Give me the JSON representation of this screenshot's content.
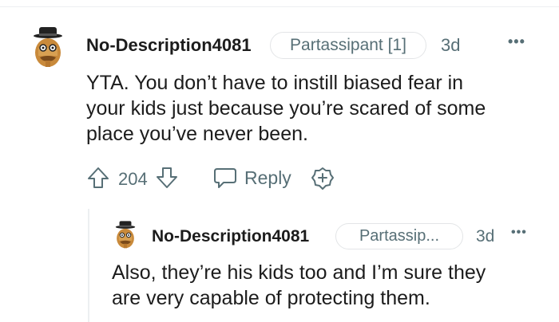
{
  "comment": {
    "username": "No-Description4081",
    "flair": "Partassipant [1]",
    "time": "3d",
    "more_label": "•••",
    "body_lines": [
      "YTA. You don’t have to instill biased fear in",
      "your kids just because you’re scared of some",
      "place you’ve never been."
    ],
    "vote_count": "204",
    "reply_label": "Reply"
  },
  "reply": {
    "username": "No-Description4081",
    "flair": "Partassip...",
    "time": "3d",
    "more_label": "•••",
    "body_lines": [
      "Also, they’re his kids too and I’m sure they",
      "are very capable of protecting them."
    ]
  },
  "colors": {
    "text": "#1c1c1c",
    "muted": "#576f76",
    "border": "#e3e5e7",
    "avatar_skin": "#c98a3b",
    "avatar_hat": "#222222"
  },
  "icons": {
    "upvote": "arrow-up-outline",
    "downvote": "arrow-down-outline",
    "reply": "chat-bubble-outline",
    "award": "plus-badge-outline",
    "more": "horizontal-ellipsis"
  }
}
